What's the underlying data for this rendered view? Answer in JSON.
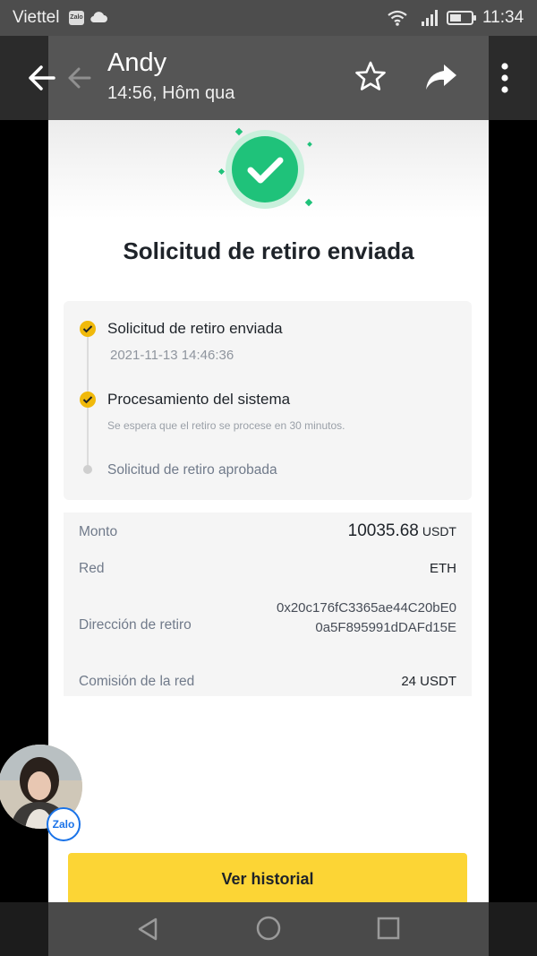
{
  "status_bar": {
    "carrier": "Viettel",
    "zalo_chip": "Zalo",
    "time": "11:34"
  },
  "viewer_header": {
    "sender": "Andy",
    "timestamp": "14:56, Hôm qua"
  },
  "screenshot": {
    "title": "Solicitud de retiro enviada",
    "steps": [
      {
        "label": "Solicitud de retiro enviada",
        "detail": "2021-11-13 14:46:36",
        "status": "done"
      },
      {
        "label": "Procesamiento del sistema",
        "detail": "Se espera que el retiro se procese en 30 minutos.",
        "status": "done"
      },
      {
        "label": "Solicitud de retiro aprobada",
        "detail": "",
        "status": "pending"
      }
    ],
    "details": {
      "amount_label": "Monto",
      "amount_value": "10035.68",
      "amount_unit": "USDT",
      "network_label": "Red",
      "network_value": "ETH",
      "address_label": "Dirección de retiro",
      "address_line1": "0x20c176fC3365ae44C20bE0",
      "address_line2": "0a5F895991dDAFd15E",
      "fee_label": "Comisión de la red",
      "fee_value": "24 USDT"
    },
    "history_button": "Ver historial"
  },
  "chat_head": {
    "badge": "Zalo"
  },
  "colors": {
    "accent": "#fcd535",
    "success": "#1fc27a",
    "step_done": "#f0b90b"
  },
  "icons": [
    "back-arrow-icon",
    "star-icon",
    "share-icon",
    "more-icon",
    "checkmark-icon",
    "wifi-icon",
    "signal-icon",
    "battery-icon",
    "cloud-icon"
  ]
}
